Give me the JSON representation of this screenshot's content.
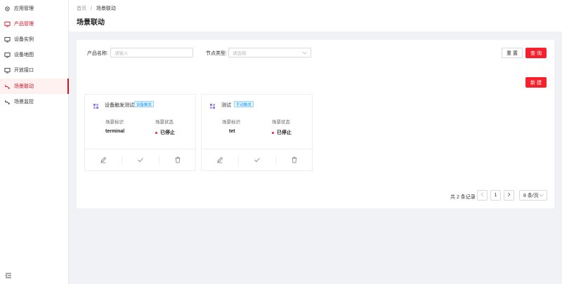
{
  "sidebar": {
    "items": [
      {
        "label": "应用管理",
        "icon": "settings-icon"
      },
      {
        "label": "产品管理",
        "icon": "monitor-icon"
      },
      {
        "label": "设备实例",
        "icon": "monitor-icon"
      },
      {
        "label": "设备地图",
        "icon": "monitor-icon"
      },
      {
        "label": "开放接口",
        "icon": "monitor-icon"
      },
      {
        "label": "场景联动",
        "icon": "link-icon"
      },
      {
        "label": "场景监控",
        "icon": "link-icon"
      }
    ],
    "active_index": 5,
    "accent": "#cf1322"
  },
  "breadcrumb": {
    "home": "首页",
    "separator": "/",
    "current": "场景联动"
  },
  "page_title": "场景联动",
  "filters": {
    "product_name_label": "产品名称:",
    "product_name_placeholder": "请输入",
    "node_type_label": "节点类型:",
    "node_type_placeholder": "请选择"
  },
  "buttons": {
    "reset": "重 置",
    "query": "查 询",
    "create": "新 建"
  },
  "cards": [
    {
      "name": "设备触发测试",
      "tag": "设备触发",
      "id_label": "场景标识",
      "id_value": "terminal",
      "status_label": "场景状态",
      "status_value": "已停止"
    },
    {
      "name": "测试",
      "tag": "手动触发",
      "id_label": "场景标识",
      "id_value": "tet",
      "status_label": "场景状态",
      "status_value": "已停止"
    }
  ],
  "pagination": {
    "total_text": "共 2 条记录",
    "current_page": "1",
    "page_size": "8 条/页"
  },
  "colors": {
    "primary": "#f5222d",
    "tag_blue": "#1890ff"
  }
}
